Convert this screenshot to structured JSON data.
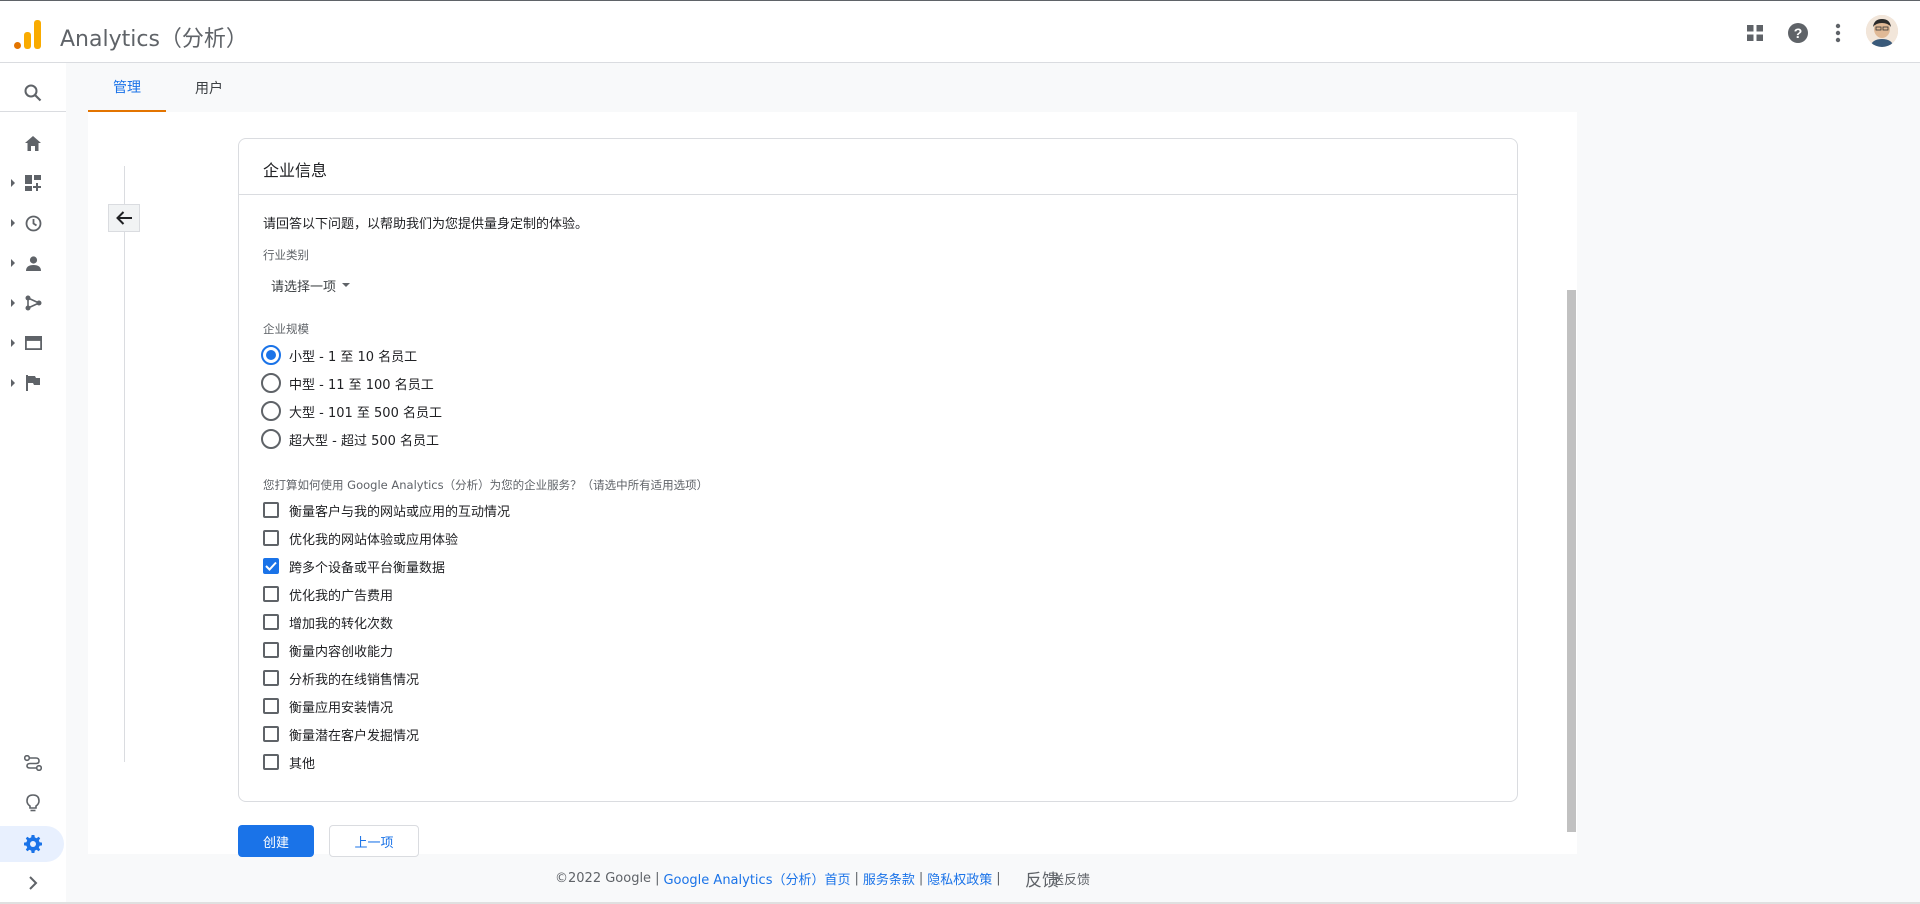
{
  "header": {
    "app_title": "Analytics（分析）",
    "icons": [
      "apps-icon",
      "help-icon",
      "more-vert-icon",
      "avatar"
    ]
  },
  "rail": {
    "items": [
      "search-icon",
      "home-icon",
      "dashboard-icon",
      "realtime-icon",
      "audience-icon",
      "acquisition-icon",
      "behavior-icon",
      "conversions-icon",
      "attribution-icon",
      "discover-icon",
      "admin-icon",
      "expand-icon"
    ]
  },
  "tabs": [
    {
      "label": "管理",
      "active": true
    },
    {
      "label": "用户",
      "active": false
    }
  ],
  "card": {
    "title": "企业信息",
    "intro": "请回答以下问题，以帮助我们为您提供量身定制的体验。",
    "industry": {
      "label": "行业类别",
      "selected": "请选择一项"
    },
    "size": {
      "label": "企业规模",
      "options": [
        {
          "label": "小型 - 1 至 10 名员工",
          "checked": true
        },
        {
          "label": "中型 - 11 至 100 名员工",
          "checked": false
        },
        {
          "label": "大型 - 101 至 500 名员工",
          "checked": false
        },
        {
          "label": "超大型 - 超过 500 名员工",
          "checked": false
        }
      ]
    },
    "usage": {
      "label": "您打算如何使用 Google Analytics（分析）为您的企业服务？（请选中所有适用选项）",
      "options": [
        {
          "label": "衡量客户与我的网站或应用的互动情况",
          "checked": false
        },
        {
          "label": "优化我的网站体验或应用体验",
          "checked": false
        },
        {
          "label": "跨多个设备或平台衡量数据",
          "checked": true
        },
        {
          "label": "优化我的广告费用",
          "checked": false
        },
        {
          "label": "增加我的转化次数",
          "checked": false
        },
        {
          "label": "衡量内容创收能力",
          "checked": false
        },
        {
          "label": "分析我的在线销售情况",
          "checked": false
        },
        {
          "label": "衡量应用安装情况",
          "checked": false
        },
        {
          "label": "衡量潜在客户发掘情况",
          "checked": false
        },
        {
          "label": "其他",
          "checked": false
        }
      ]
    }
  },
  "buttons": {
    "create": "创建",
    "previous": "上一项"
  },
  "footer": {
    "copyright": "©2022 Google",
    "links": [
      "Google Analytics（分析）首页",
      "服务条款",
      "隐私权政策"
    ],
    "feedback_big": "反馈",
    "feedback_small": "送反馈"
  },
  "colors": {
    "accent": "#1a73e8",
    "tab_underline": "#e37400",
    "logo_orange": "#f9ab00"
  }
}
